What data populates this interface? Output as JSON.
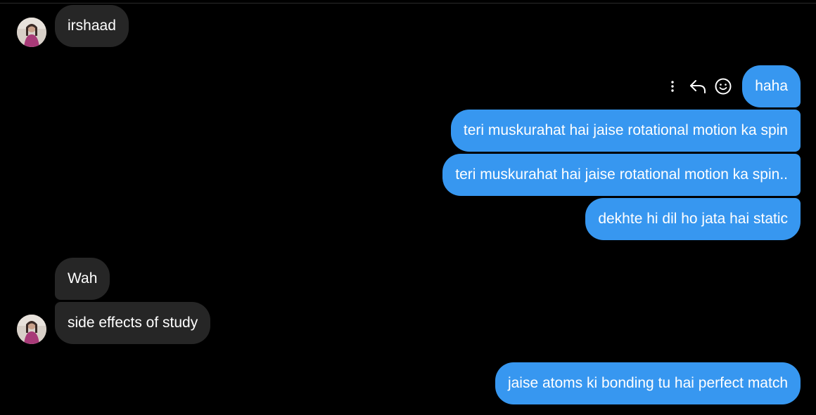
{
  "conversation": {
    "messages": [
      {
        "text": "irshaad",
        "direction": "incoming"
      },
      {
        "text": "haha",
        "direction": "outgoing"
      },
      {
        "text": "teri muskurahat hai jaise rotational motion ka spin",
        "direction": "outgoing"
      },
      {
        "text": "teri muskurahat hai jaise rotational motion ka spin..",
        "direction": "outgoing"
      },
      {
        "text": "dekhte hi dil ho jata hai static",
        "direction": "outgoing"
      },
      {
        "text": "Wah",
        "direction": "incoming"
      },
      {
        "text": "side effects of study",
        "direction": "incoming"
      },
      {
        "text": "jaise atoms ki bonding tu hai perfect match",
        "direction": "outgoing"
      }
    ],
    "hover_actions": [
      {
        "icon": "more-options-icon"
      },
      {
        "icon": "reply-icon"
      },
      {
        "icon": "emoji-reaction-icon"
      }
    ]
  },
  "colors": {
    "background": "#000000",
    "incoming_bubble": "#262626",
    "outgoing_bubble": "#3797f0",
    "text": "#ffffff"
  }
}
